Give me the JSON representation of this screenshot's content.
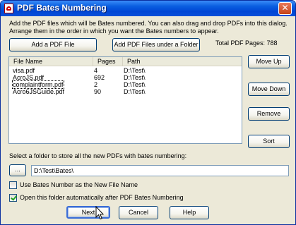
{
  "window": {
    "title": "PDF Bates Numbering",
    "close_glyph": "✕"
  },
  "instructions": {
    "line1": "Add the PDF files which will be Bates numbered. You can also drag and drop PDFs into this dialog.",
    "line2": "Arrange them in the order in which you want the Bates numbers to appear."
  },
  "buttons": {
    "add_file": "Add a PDF File",
    "add_folder": "Add PDF Files under a Folder",
    "move_up": "Move Up",
    "move_down": "Move Down",
    "remove": "Remove",
    "sort": "Sort",
    "browse": "...",
    "next": "Next",
    "cancel": "Cancel",
    "help": "Help"
  },
  "total_pages": "Total PDF Pages: 788",
  "file_list": {
    "columns": [
      "File Name",
      "Pages",
      "Path"
    ],
    "rows": [
      {
        "name": "visa.pdf",
        "pages": "4",
        "path": "D:\\Test\\"
      },
      {
        "name": "AcroJS.pdf",
        "pages": "692",
        "path": "D:\\Test\\"
      },
      {
        "name": "complaintform.pdf",
        "pages": "2",
        "path": "D:\\Test\\"
      },
      {
        "name": "Acro6JSGuide.pdf",
        "pages": "90",
        "path": "D:\\Test\\"
      }
    ],
    "focused_row": 2
  },
  "output_folder": {
    "caption": "Select a folder to store all the new PDFs with bates numbering:",
    "value": "D:\\Test\\Bates\\"
  },
  "options": {
    "use_bates_as_name": {
      "label": "Use Bates Number as the New File Name",
      "checked": false
    },
    "open_folder": {
      "label": "Open this folder automatically after PDF Bates Numbering",
      "checked": true
    }
  },
  "colors": {
    "title_bar": "#0046d5",
    "dialog_bg": "#ece9d8",
    "check_tick": "#21a121"
  },
  "icons": {
    "app": "pdf-app-icon",
    "cursor": "mouse-pointer-icon"
  }
}
